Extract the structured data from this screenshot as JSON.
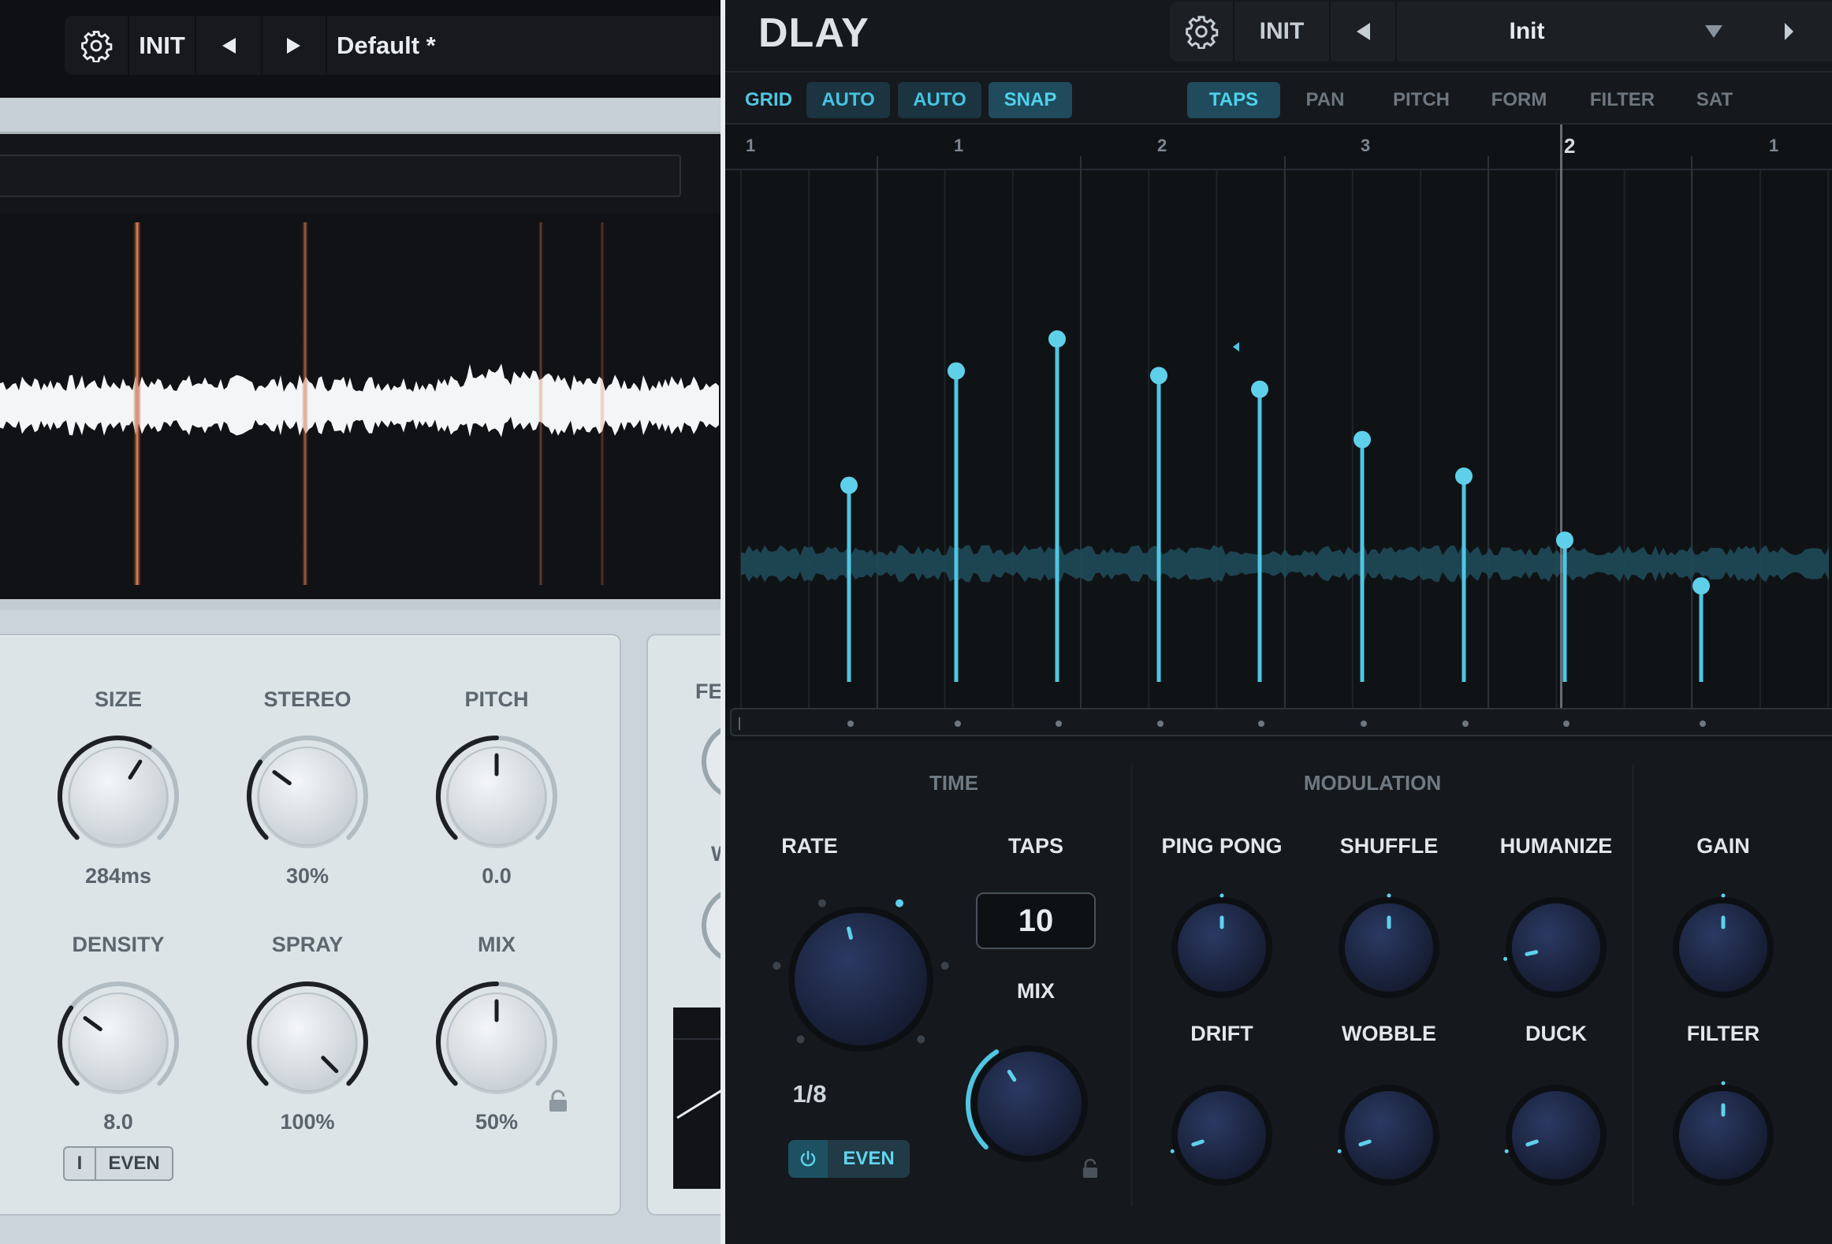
{
  "left_plugin": {
    "toolbar": {
      "gear_icon": "gear-icon",
      "init_label": "INIT",
      "prev_icon": "triangle-left-icon",
      "next_icon": "triangle-right-icon",
      "preset_name": "Default *"
    },
    "knobs": [
      {
        "label": "SIZE",
        "value": "284ms",
        "level": 0.62
      },
      {
        "label": "STEREO",
        "value": "30%",
        "level": 0.3
      },
      {
        "label": "PITCH",
        "value": "0.0",
        "level": 0.5
      },
      {
        "label": "DENSITY",
        "value": "8.0",
        "level": 0.3
      },
      {
        "label": "SPRAY",
        "value": "100%",
        "level": 1.0
      },
      {
        "label": "MIX",
        "value": "50%",
        "level": 0.5
      }
    ],
    "density_toggle": {
      "left": "I",
      "right": "EVEN"
    },
    "second_panel_labels": [
      "FE",
      "W"
    ],
    "accent": "#e0805a"
  },
  "right_plugin": {
    "logo": "DLAY",
    "toolbar": {
      "gear_icon": "gear-icon",
      "init_label": "INIT",
      "prev_icon": "triangle-left-icon",
      "preset_name": "Init",
      "dropdown_icon": "triangle-down-icon"
    },
    "tabs_left": [
      {
        "label": "GRID",
        "state": "text"
      },
      {
        "label": "AUTO",
        "state": "dim"
      },
      {
        "label": "AUTO",
        "state": "dim"
      },
      {
        "label": "SNAP",
        "state": "on"
      }
    ],
    "tabs_right": [
      {
        "label": "TAPS",
        "state": "on"
      },
      {
        "label": "PAN",
        "state": "off"
      },
      {
        "label": "PITCH",
        "state": "off"
      },
      {
        "label": "FORM",
        "state": "off"
      },
      {
        "label": "FILTER",
        "state": "off"
      },
      {
        "label": "SAT",
        "state": "off"
      }
    ],
    "ruler": [
      "1",
      "1",
      "2",
      "3",
      "2",
      "1"
    ],
    "tap_levels": [
      0.43,
      0.68,
      0.75,
      0.67,
      0.64,
      0.53,
      0.45,
      0.31,
      0.21
    ],
    "sections": {
      "time": "TIME",
      "modulation": "MODULATION"
    },
    "rate": {
      "label": "RATE",
      "value": "1/8",
      "even_label": "EVEN",
      "power_icon": "power-icon"
    },
    "taps": {
      "label": "TAPS",
      "value": "10"
    },
    "mix": {
      "label": "MIX",
      "level": 0.38
    },
    "mod_knobs": [
      {
        "label": "PING PONG",
        "level": 0.5
      },
      {
        "label": "SHUFFLE",
        "level": 0.5
      },
      {
        "label": "HUMANIZE",
        "level": 0.12
      },
      {
        "label": "GAIN",
        "level": 0.5
      },
      {
        "label": "DRIFT",
        "level": 0.1
      },
      {
        "label": "WOBBLE",
        "level": 0.1
      },
      {
        "label": "DUCK",
        "level": 0.1
      },
      {
        "label": "FILTER",
        "level": 0.5
      }
    ],
    "accent": "#4fc6e3"
  }
}
